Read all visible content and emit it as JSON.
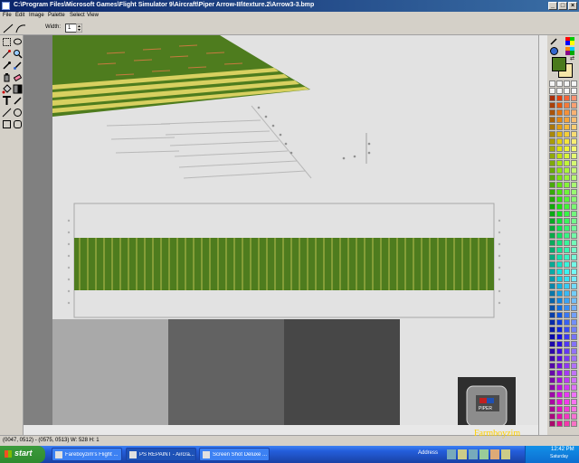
{
  "window": {
    "title": "C:\\Program Files\\Microsoft Games\\Flight Simulator 9\\Aircraft\\Piper Arrow-III\\texture.2\\Arrow3-3.bmp",
    "controls": [
      "_",
      "□",
      "×"
    ]
  },
  "menu": {
    "items": [
      "File",
      "Edit",
      "Image",
      "Palette",
      "Select",
      "View"
    ]
  },
  "toolbar": {
    "width_label": "Width:",
    "width_value": "1"
  },
  "statusbar": {
    "text": "(0047, 0512) - (0575, 0513)  W: 528  H: 1"
  },
  "palette": {
    "primary_color": "#4a7a1c",
    "secondary_color": "#f5e6a8"
  },
  "canvas": {
    "stripe_green": "#4e7c1e",
    "stripe_yellow": "#d8d060",
    "swatches": [
      "#a9a9a9",
      "#626262",
      "#474747"
    ],
    "badge_text": "PIPER"
  },
  "taskbar": {
    "start_label": "start",
    "tasks": [
      "Fareboyzim's Flight ...",
      "PS REPAINT - Aircra...",
      "Screen Shot Deluxe ..."
    ],
    "address_label": "Address",
    "clock_time": "12:42 PM",
    "clock_day": "Saturday"
  },
  "overlay": {
    "text": "Farmboyzim"
  }
}
